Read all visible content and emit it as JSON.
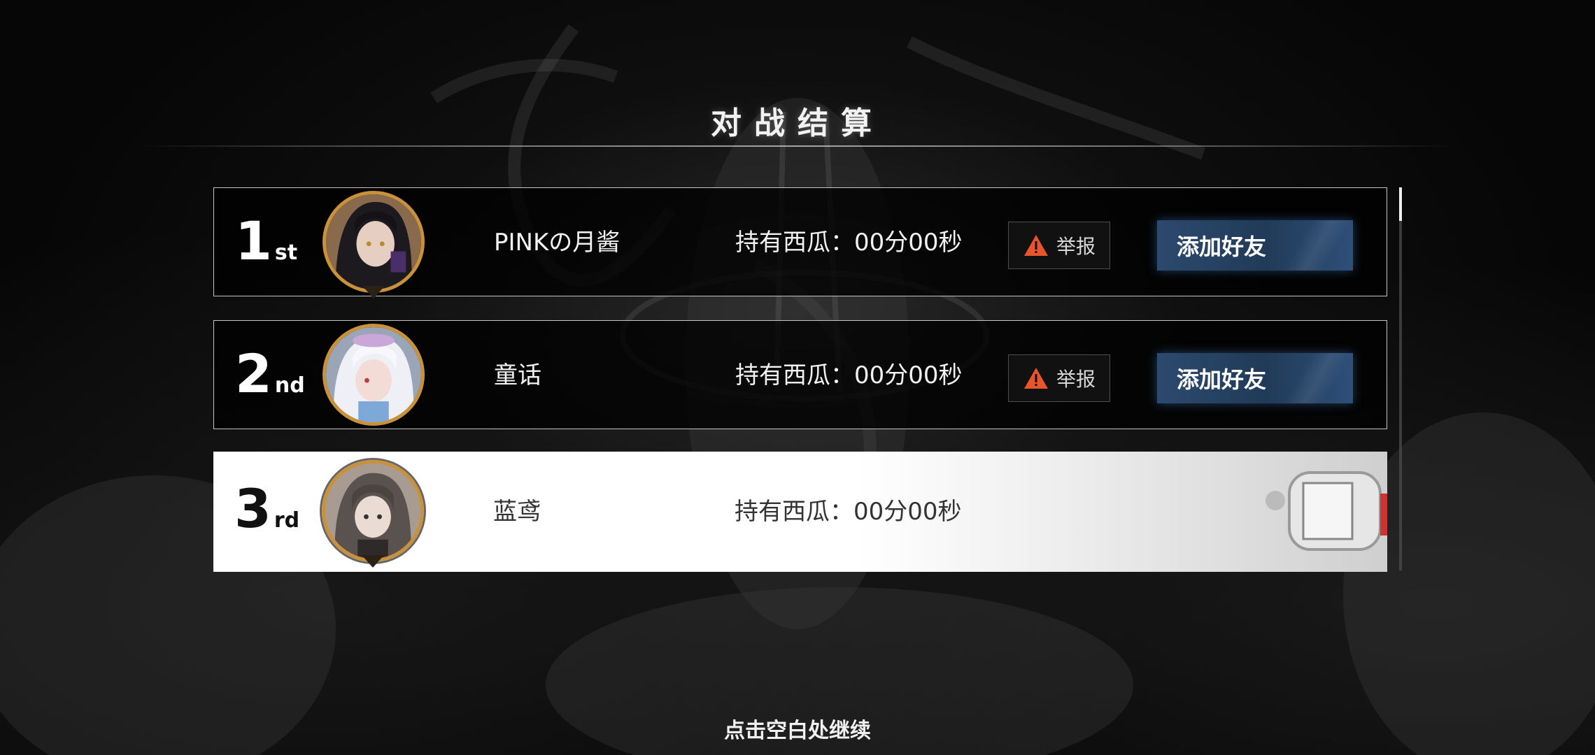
{
  "screen": {
    "title": "对战结算",
    "continue_hint": "点击空白处继续"
  },
  "results": [
    {
      "rank_num": "1",
      "rank_suffix": "st",
      "player_name": "PINKの月酱",
      "hold_time": "持有西瓜：00分00秒",
      "report_label": "举报",
      "add_friend_label": "添加好友",
      "avatar": "dark-hair-character"
    },
    {
      "rank_num": "2",
      "rank_suffix": "nd",
      "player_name": "童话",
      "hold_time": "持有西瓜：00分00秒",
      "report_label": "举报",
      "add_friend_label": "添加好友",
      "avatar": "white-hair-character"
    },
    {
      "rank_num": "3",
      "rank_suffix": "rd",
      "player_name": "蓝鸢",
      "hold_time": "持有西瓜：00分00秒",
      "avatar": "gray-hair-character"
    }
  ],
  "colors": {
    "report_icon": "#e8542b",
    "friend_button": "#2c4a6e",
    "avatar_ring": "#c8913a"
  }
}
